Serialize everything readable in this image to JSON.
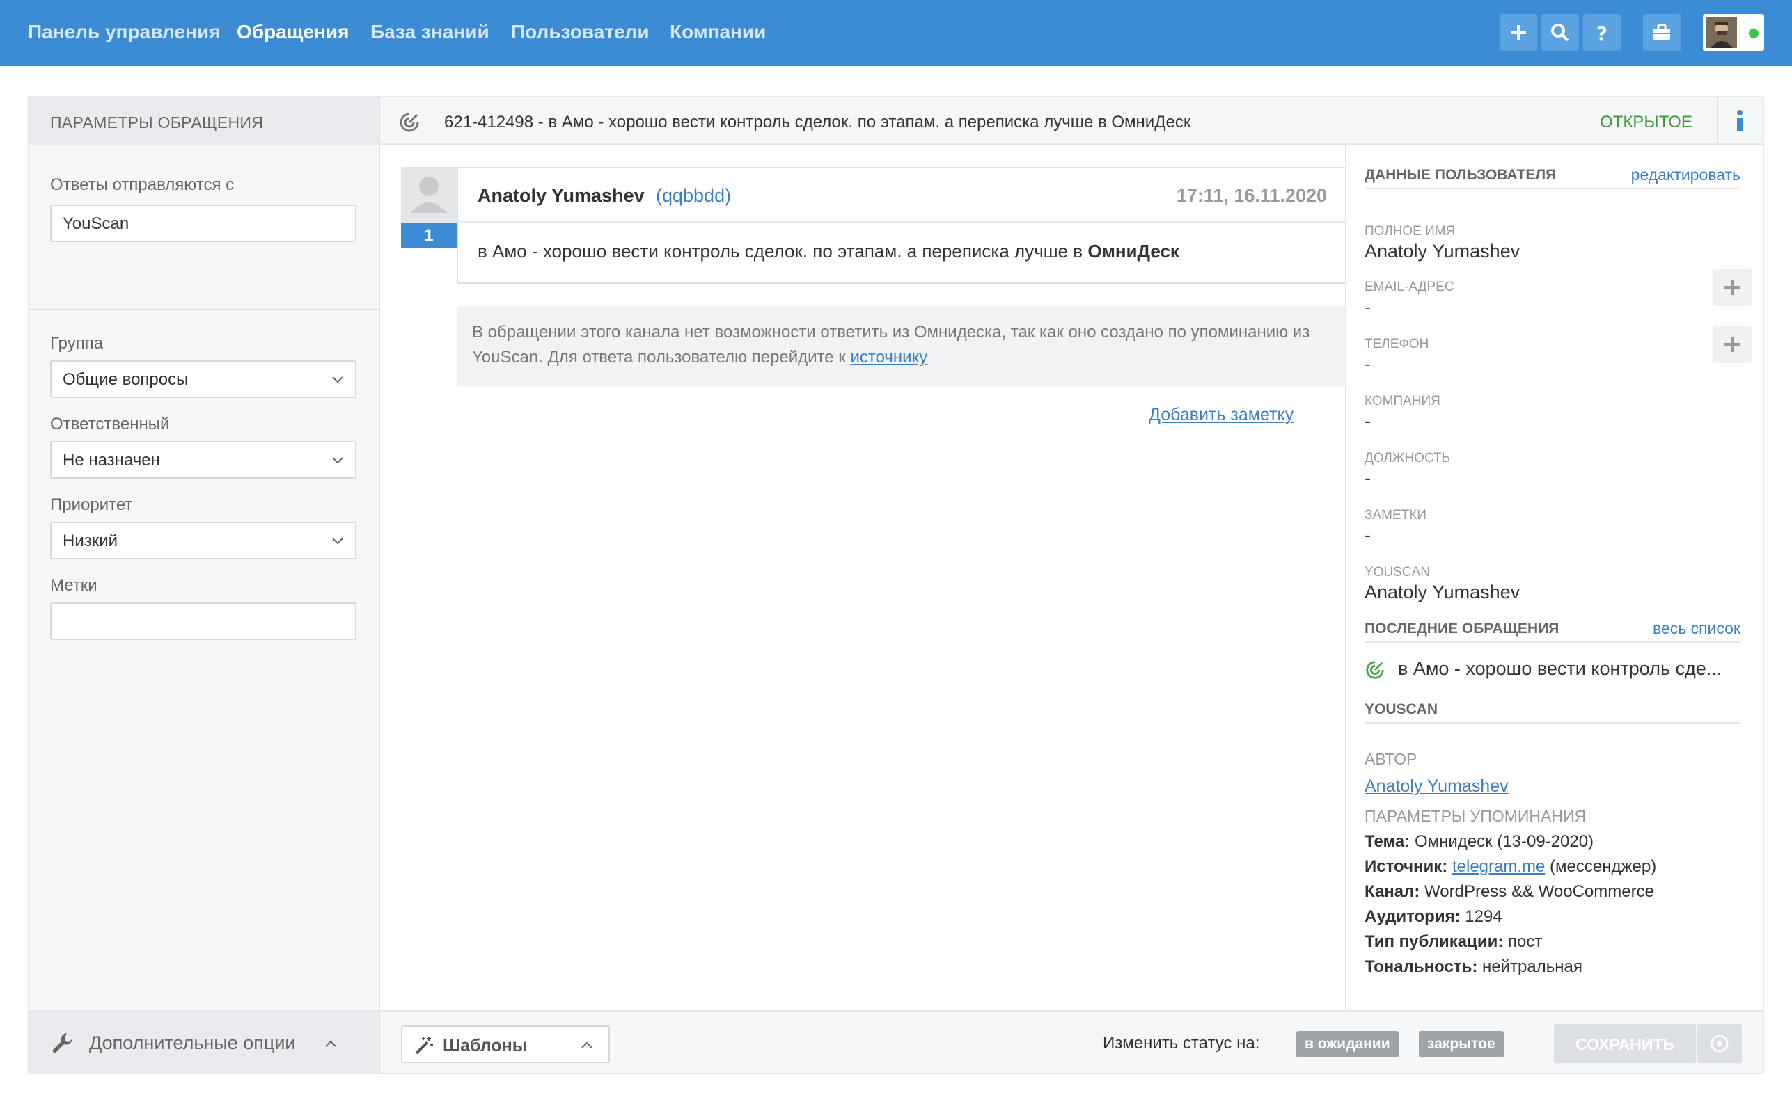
{
  "nav": {
    "items": [
      "Панель управления",
      "Обращения",
      "База знаний",
      "Пользователи",
      "Компании"
    ],
    "active": "Обращения",
    "icons": [
      "plus-icon",
      "search-icon",
      "help-icon",
      "briefcase-icon"
    ],
    "colors": {
      "bar": "#3b8cd4",
      "button": "#5aa2e0",
      "online": "#2ecc40"
    }
  },
  "case": {
    "params_title": "ПАРАМЕТРЫ ОБРАЩЕНИЯ",
    "subject": "621-412498 - в Амо - хорошо вести контроль сделок. по этапам. а переписка лучше в ОмниДеск",
    "status": "ОТКРЫТОЕ",
    "status_color": "#3a9a3a"
  },
  "left": {
    "reply_from_label": "Ответы отправляются с",
    "reply_from_value": "YouScan",
    "group_label": "Группа",
    "group_value": "Общие вопросы",
    "assignee_label": "Ответственный",
    "assignee_value": "Не назначен",
    "priority_label": "Приоритет",
    "priority_value": "Низкий",
    "tags_label": "Метки",
    "tags_value": ""
  },
  "message": {
    "number": "1",
    "author": "Anatoly Yumashev",
    "handle": "(qqbbdd)",
    "time": "17:11, 16.11.2020",
    "body_text": "в Амо - хорошо вести контроль сделок. по этапам. а переписка лучше в ",
    "body_bold": "ОмниДеск",
    "notice_text": "В обращении этого канала нет возможности ответить из Омнидеска, так как оно создано по упоминанию из YouScan. Для ответа пользователю перейдите к ",
    "notice_link": "источнику",
    "add_note": "Добавить заметку"
  },
  "user": {
    "section_title": "ДАННЫЕ ПОЛЬЗОВАТЕЛЯ",
    "edit_link": "редактировать",
    "fullname_label": "ПОЛНОЕ ИМЯ",
    "fullname": "Anatoly Yumashev",
    "email_label": "EMAIL-АДРЕС",
    "email": "-",
    "phone_label": "ТЕЛЕФОН",
    "phone": "-",
    "company_label": "КОМПАНИЯ",
    "company": "-",
    "position_label": "ДОЛЖНОСТЬ",
    "position": "-",
    "notes_label": "ЗАМЕТКИ",
    "notes": "-",
    "youscan_label": "YOUSCAN",
    "youscan": "Anatoly Yumashev"
  },
  "recent": {
    "section_title": "ПОСЛЕДНИЕ ОБРАЩЕНИЯ",
    "all_link": "весь список",
    "items": [
      "в Амо - хорошо вести контроль сде..."
    ]
  },
  "youscan": {
    "section_title": "YOUSCAN",
    "author_label": "АВТОР",
    "author": "Anatoly Yumashev",
    "mention_label": "ПАРАМЕТРЫ УПОМИНАНИЯ",
    "topic_key": "Тема:",
    "topic": "Омнидеск (13-09-2020)",
    "source_key": "Источник:",
    "source_link": "telegram.me",
    "source_type": "(мессенджер)",
    "channel_key": "Канал:",
    "channel": "WordPress && WooCommerce",
    "audience_key": "Аудитория:",
    "audience": "1294",
    "pubtype_key": "Тип публикации:",
    "pubtype": "пост",
    "tone_key": "Тональность:",
    "tone": "нейтральная"
  },
  "footer": {
    "more_options": "Дополнительные опции",
    "templates": "Шаблоны",
    "change_status": "Изменить статус на:",
    "status_pending": "в ожидании",
    "status_closed": "закрытое",
    "save": "СОХРАНИТЬ"
  }
}
